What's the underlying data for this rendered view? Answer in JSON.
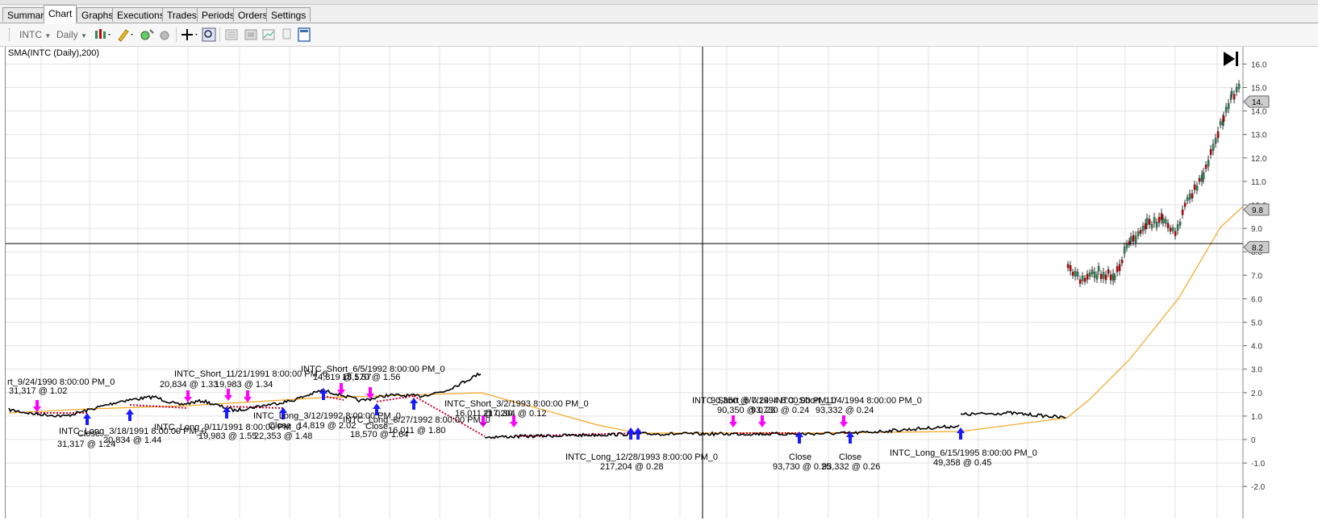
{
  "tabs": [
    {
      "label": "Summary",
      "active": false
    },
    {
      "label": "Chart",
      "active": true
    },
    {
      "label": "Graphs",
      "active": false
    },
    {
      "label": "Executions",
      "active": false
    },
    {
      "label": "Trades",
      "active": false
    },
    {
      "label": "Periods",
      "active": false
    },
    {
      "label": "Orders",
      "active": false
    },
    {
      "label": "Settings",
      "active": false
    }
  ],
  "toolbar": {
    "instrument": "INTC",
    "period": "Daily"
  },
  "chart": {
    "indicator_label": "SMA(INTC (Daily),200)",
    "y_ticks": [
      "16.0",
      "15.0",
      "14.0",
      "13.0",
      "12.0",
      "11.0",
      "10.0",
      "9.0",
      "8.0",
      "7.0",
      "6.0",
      "5.0",
      "4.0",
      "3.0",
      "2.0",
      "1.0",
      "0",
      "-1.0",
      "-2.0"
    ],
    "price_markers": [
      "14.",
      "9.8",
      "8.2"
    ],
    "annotations": [
      "rt_9/24/1990 8:00:00 PM_0",
      "31,317 @ 1.02",
      "Close",
      "31,317 @ 1.24",
      "INTC_Long_3/18/1991 8:00:00 PM_0",
      "20,834 @ 1.44",
      "INTC_Short_11/21/1991 8:00:00 PM_0",
      "20,834 @ 1.33",
      "19,983 @ 1.34",
      "INTC_Long_9/11/1991 8:00:00 PM_0",
      "19,983 @ 1.55",
      "Close",
      "22,353 @ 1.48",
      "INTC_Long_3/12/1992 8:00:00 PM_0",
      "14,819 @ 2.02",
      "INTC_Short_6/5/1992 8:00:00 PM_0",
      "14,819 @ 1.57",
      "18,570 @ 1.56",
      "INTC_Long_8/27/1992 8:00:00 PM_0",
      "Close",
      "18,570 @ 1.64",
      "16,011 @ 1.80",
      "INTC_Short_3/2/1993 8:00:00 PM_0",
      "16,011 @ 0.30",
      "217,204 @ 0.12",
      "INTC_Long_12/28/1993 8:00:00 PM_0",
      "217,204 @ 0.28",
      "90,350 @ 0.24",
      "INTC_Short_6/7/1994 8:00:00 PM_0",
      "90,350 @ 0.23",
      "93,730 @ 0.24",
      "INTC_Short_11/4/1994 8:00:00 PM_0",
      "93,332 @ 0.24",
      "Close",
      "93,730 @ 0.25",
      "Close",
      "93,332 @ 0.26",
      "INTC_Long_6/15/1995 8:00:00 PM_0",
      "49,358 @ 0.45"
    ]
  },
  "colors": {
    "sma": "#f5a623",
    "buy": "#1a1aff",
    "sell": "#ff00ff",
    "trade_line": "#cc0033",
    "price": "#000000",
    "candle_up": "#2e8b57",
    "candle_down": "#cc0000"
  }
}
